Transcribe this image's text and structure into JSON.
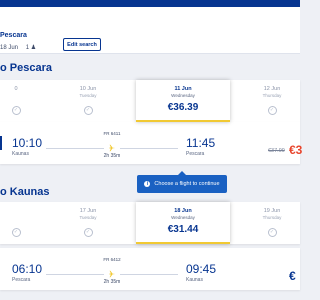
{
  "search": {
    "route": "Pescara",
    "dates": "18 Jun",
    "passengers": "1",
    "edit_label": "Edit search"
  },
  "outbound": {
    "title": "o Pescara",
    "dates": [
      {
        "day": "0",
        "weekday": "",
        "state": "check"
      },
      {
        "day": "10 Jun",
        "weekday": "Tuesday",
        "state": "check"
      },
      {
        "day": "11 Jun",
        "weekday": "Wednesday",
        "price": "€36.39",
        "selected": true
      },
      {
        "day": "12 Jun",
        "weekday": "Thursday",
        "state": "check"
      }
    ],
    "flight": {
      "dep_time": "10:10",
      "dep_city": "Kaunas",
      "number": "FR 6411",
      "duration": "2h 35m",
      "arr_time": "11:45",
      "arr_city": "Pescara",
      "old_price": "€37.99",
      "price": "€3"
    }
  },
  "inbound": {
    "title": "o Kaunas",
    "dates": [
      {
        "day": "",
        "weekday": "",
        "state": "check"
      },
      {
        "day": "17 Jun",
        "weekday": "Tuesday",
        "state": "check"
      },
      {
        "day": "18 Jun",
        "weekday": "Wednesday",
        "price": "€31.44",
        "selected": true
      },
      {
        "day": "19 Jun",
        "weekday": "Thursday",
        "state": "check"
      }
    ],
    "flight": {
      "dep_time": "06:10",
      "dep_city": "Pescara",
      "number": "FR 6412",
      "duration": "2h 35m",
      "arr_time": "09:45",
      "arr_city": "Kaunas",
      "price": "€"
    }
  },
  "toast": {
    "text": "Choose a flight to continue"
  },
  "colors": {
    "brand": "#073590",
    "accent": "#f1c933",
    "sale": "#e8452c",
    "info": "#1a61c2"
  }
}
